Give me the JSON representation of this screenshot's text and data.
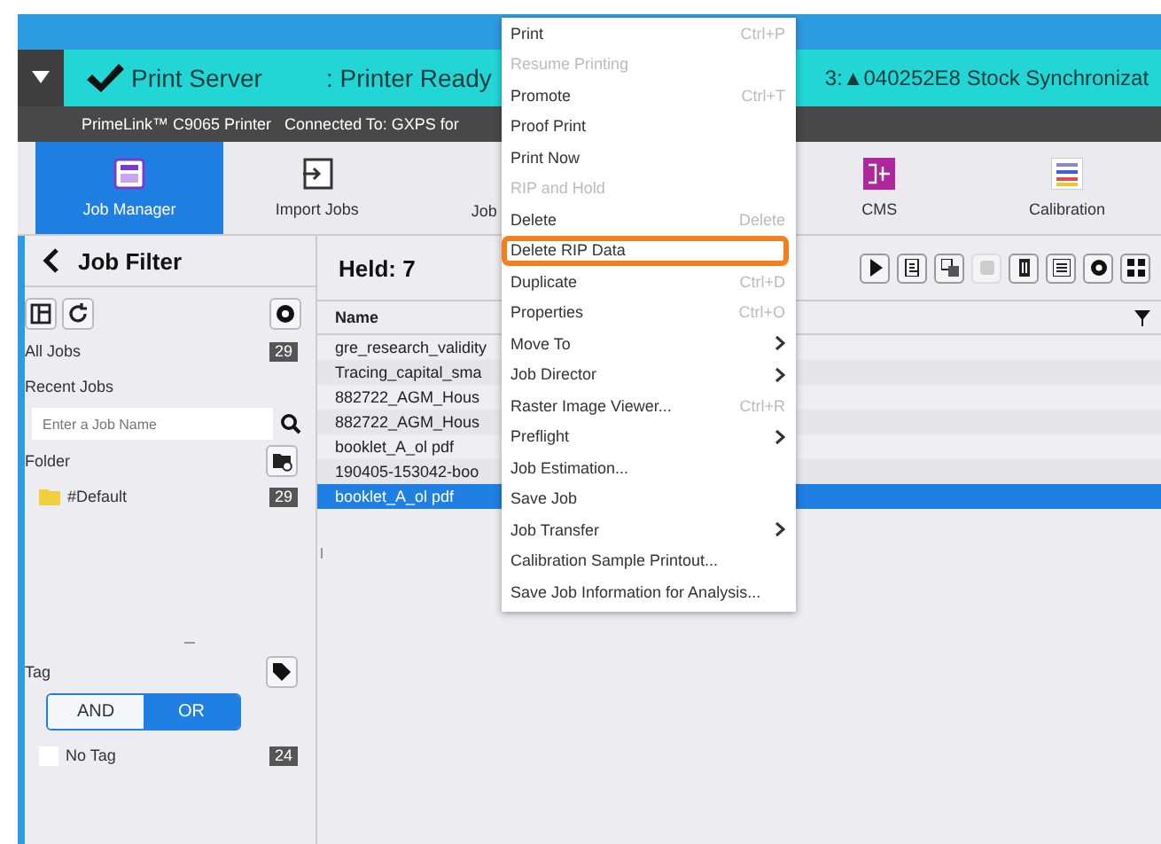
{
  "status_bar": {
    "server": "Print Server",
    "state": ": Printer Ready",
    "alert": "3:▲040252E8 Stock Synchronizat"
  },
  "printer_bar": {
    "text": "PrimeLink™ C9065 Printer   Connected To: GXPS for"
  },
  "tabs": [
    {
      "label": "Job Manager",
      "selected": true
    },
    {
      "label": "Import Jobs",
      "selected": false
    },
    {
      "label": "Job",
      "selected": false
    },
    {
      "label": "CMS",
      "selected": false
    },
    {
      "label": "Calibration",
      "selected": false
    }
  ],
  "sidebar": {
    "title": "Job Filter",
    "all_jobs": {
      "label": "All Jobs",
      "count": "29"
    },
    "recent_jobs": "Recent Jobs",
    "search": {
      "placeholder": "Enter a Job Name"
    },
    "folder": "Folder",
    "folders": [
      {
        "label": "#Default",
        "count": "29"
      }
    ],
    "tag": "Tag",
    "logic": [
      {
        "label": "AND",
        "selected": false
      },
      {
        "label": "OR",
        "selected": true
      }
    ],
    "tags": [
      {
        "label": "No Tag",
        "count": "24",
        "checked": false
      }
    ]
  },
  "main": {
    "title": "Held: 7",
    "column": "Name",
    "rows": [
      {
        "name": "gre_research_validity",
        "selected": false
      },
      {
        "name": "Tracing_capital_sma",
        "selected": false
      },
      {
        "name": "882722_AGM_Hous",
        "selected": false
      },
      {
        "name": "882722_AGM_Hous",
        "selected": false
      },
      {
        "name": "booklet_A_ol pdf",
        "selected": false
      },
      {
        "name": "190405-153042-boo",
        "selected": false
      },
      {
        "name": "booklet_A_ol pdf",
        "selected": true
      }
    ]
  },
  "context_menu": [
    {
      "kind": "item",
      "label": "Print",
      "shortcut": "Ctrl+P",
      "disabled": false,
      "highlighted": false
    },
    {
      "kind": "item",
      "label": "Resume Printing",
      "disabled": true,
      "highlighted": false
    },
    {
      "kind": "item",
      "label": "Promote",
      "shortcut": "Ctrl+T",
      "disabled": false,
      "highlighted": false
    },
    {
      "kind": "item",
      "label": "Proof Print",
      "disabled": false,
      "highlighted": false
    },
    {
      "kind": "item",
      "label": "Print Now",
      "disabled": false,
      "highlighted": false
    },
    {
      "kind": "item",
      "label": "RIP and Hold",
      "disabled": true,
      "highlighted": false
    },
    {
      "kind": "item",
      "label": "Delete",
      "shortcut": "Delete",
      "disabled": false,
      "highlighted": false
    },
    {
      "kind": "item",
      "label": "Delete RIP Data",
      "disabled": false,
      "highlighted": true
    },
    {
      "kind": "item",
      "label": "Duplicate",
      "shortcut": "Ctrl+D",
      "disabled": false,
      "highlighted": false
    },
    {
      "kind": "item",
      "label": "Properties",
      "shortcut": "Ctrl+O",
      "disabled": false,
      "highlighted": false
    },
    {
      "kind": "submenu",
      "label": "Move To",
      "disabled": false,
      "highlighted": false
    },
    {
      "kind": "submenu",
      "label": "Job Director",
      "disabled": false,
      "highlighted": false
    },
    {
      "kind": "item",
      "label": "Raster Image Viewer...",
      "shortcut": "Ctrl+R",
      "disabled": false,
      "highlighted": false
    },
    {
      "kind": "submenu",
      "label": "Preflight",
      "disabled": false,
      "highlighted": false
    },
    {
      "kind": "item",
      "label": "Job Estimation...",
      "disabled": false,
      "highlighted": false
    },
    {
      "kind": "item",
      "label": "Save Job",
      "disabled": false,
      "highlighted": false
    },
    {
      "kind": "submenu",
      "label": "Job Transfer",
      "disabled": false,
      "highlighted": false
    },
    {
      "kind": "item",
      "label": "Calibration Sample Printout...",
      "disabled": false,
      "highlighted": false
    },
    {
      "kind": "item",
      "label": "Save Job Information for Analysis...",
      "disabled": false,
      "highlighted": false
    }
  ]
}
